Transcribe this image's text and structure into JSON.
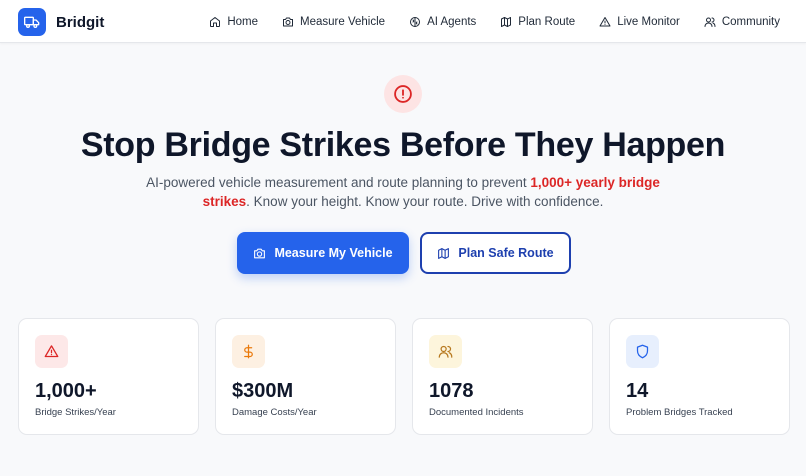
{
  "brand": {
    "name": "Bridgit",
    "icon": "truck-icon",
    "color": "#2563eb"
  },
  "nav": [
    {
      "label": "Home",
      "icon": "home-icon"
    },
    {
      "label": "Measure Vehicle",
      "icon": "camera-icon"
    },
    {
      "label": "AI Agents",
      "icon": "brain-icon"
    },
    {
      "label": "Plan Route",
      "icon": "map-icon"
    },
    {
      "label": "Live Monitor",
      "icon": "alert-triangle-icon"
    },
    {
      "label": "Community",
      "icon": "users-icon"
    }
  ],
  "hero": {
    "icon": "alert-circle-icon",
    "title": "Stop Bridge Strikes Before They Happen",
    "subtitle_before": "AI-powered vehicle measurement and route planning to prevent ",
    "subtitle_highlight": "1,000+ yearly bridge strikes",
    "subtitle_after": ". Know your height. Know your route. Drive with confidence.",
    "primary_button": "Measure My Vehicle",
    "secondary_button": "Plan Safe Route"
  },
  "stats": [
    {
      "value": "1,000+",
      "label": "Bridge Strikes/Year",
      "icon": "alert-triangle-icon",
      "color": "#dc2626",
      "bg": "#fde8e8"
    },
    {
      "value": "$300M",
      "label": "Damage Costs/Year",
      "icon": "dollar-icon",
      "color": "#ea7a0c",
      "bg": "#fdf0e2"
    },
    {
      "value": "1078",
      "label": "Documented Incidents",
      "icon": "users-icon",
      "color": "#b7791f",
      "bg": "#fdf5dc"
    },
    {
      "value": "14",
      "label": "Problem Bridges Tracked",
      "icon": "shield-icon",
      "color": "#2563eb",
      "bg": "#e7effd"
    }
  ]
}
